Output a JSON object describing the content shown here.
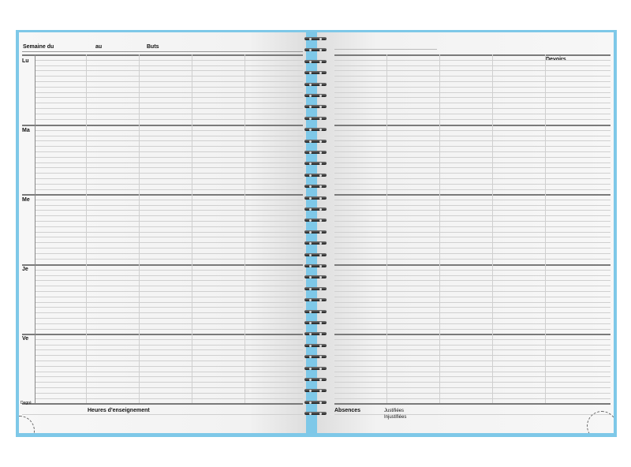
{
  "planner": {
    "left_header": {
      "week_label": "Semaine du",
      "to_label": "au",
      "goals_label": "Buts"
    },
    "days": [
      "Lu",
      "Ma",
      "Me",
      "Je",
      "Ve"
    ],
    "degree_label": "Degré",
    "teaching_hours_label": "Heures d'enseignement",
    "homework_label": "Devoirs",
    "absences": {
      "label": "Absences",
      "justified": "Justifiées",
      "unjustified": "Injustifiées"
    }
  },
  "colors": {
    "cover": "#7ec8e8",
    "page": "#f6f6f6",
    "rule": "#d0d0d0",
    "day_divider": "#7a7a7a",
    "spiral": "#2a2a2a"
  }
}
